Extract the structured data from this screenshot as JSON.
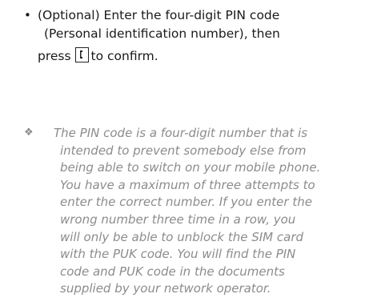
{
  "step": {
    "bullet": "•",
    "line1": "(Optional) Enter the four-digit PIN code",
    "line2": "(Personal identification number), then",
    "line3_before": "press",
    "line3_after": "to confirm.",
    "key_icon": "call-key-icon"
  },
  "note": {
    "icon": "❖",
    "lines": [
      "The PIN code is a four-digit number that is",
      "intended to prevent somebody else from",
      "being able to switch on your mobile phone.",
      "You have a maximum of three attempts to",
      "enter the correct number. If you enter the",
      "wrong number three time in a row, you",
      "will only be able to unblock the SIM card",
      "with the PUK code. You will find the PIN",
      "code and PUK code in the documents",
      "supplied by your network operator."
    ]
  }
}
